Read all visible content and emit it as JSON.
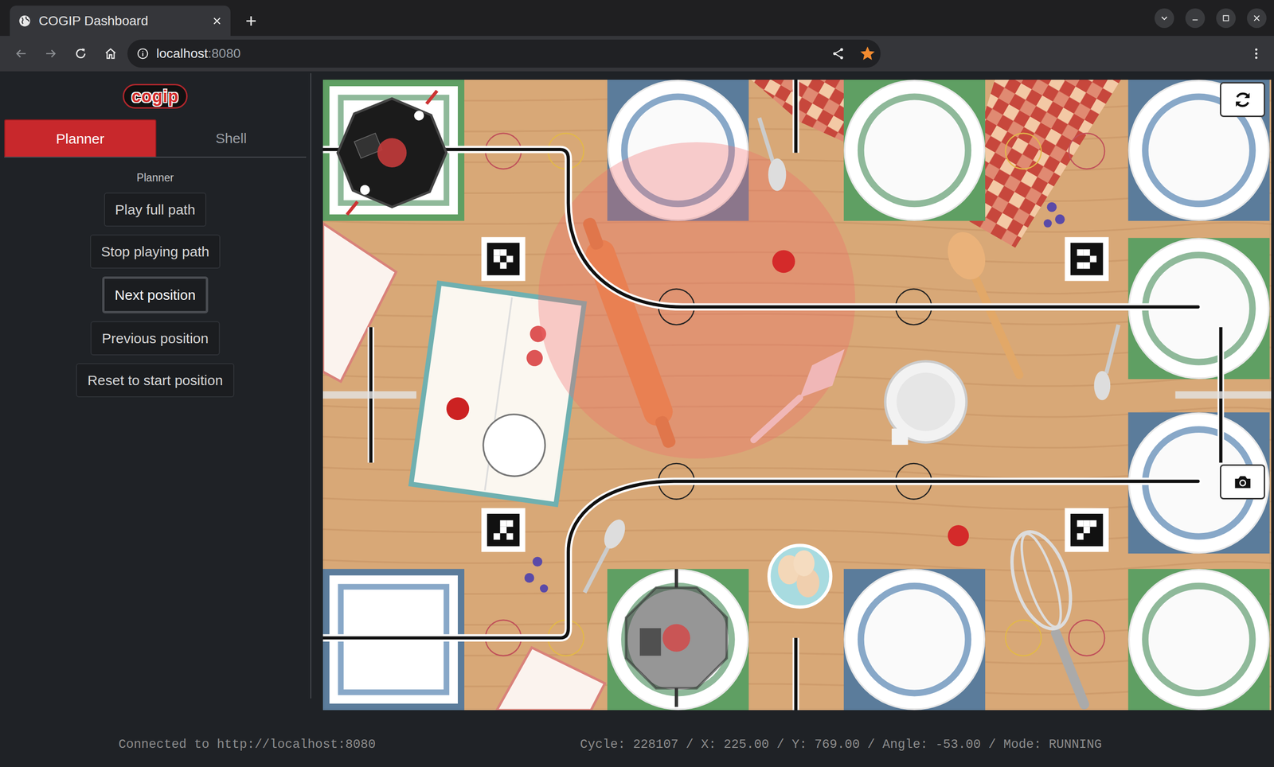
{
  "window": {
    "title": "COGIP Dashboard",
    "selected": true
  },
  "browser": {
    "address": {
      "host": "localhost",
      "port": ":8080"
    },
    "bookmarked": true
  },
  "app": {
    "logo": "cogip",
    "tabs": [
      {
        "label": "Planner",
        "selected": true
      },
      {
        "label": "Shell",
        "selected": false
      }
    ],
    "panel_title": "Planner",
    "buttons": [
      {
        "label": "Play full path",
        "focused": false
      },
      {
        "label": "Stop playing path",
        "focused": false
      },
      {
        "label": "Next position",
        "focused": true
      },
      {
        "label": "Previous position",
        "focused": false
      },
      {
        "label": "Reset to start position",
        "focused": false
      }
    ]
  },
  "status_bar": {
    "connection": "Connected to http://localhost:8080",
    "telemetry": "Cycle: 228107 / X: 225.00 / Y: 769.00 / Angle: -53.00 / Mode: RUNNING"
  }
}
